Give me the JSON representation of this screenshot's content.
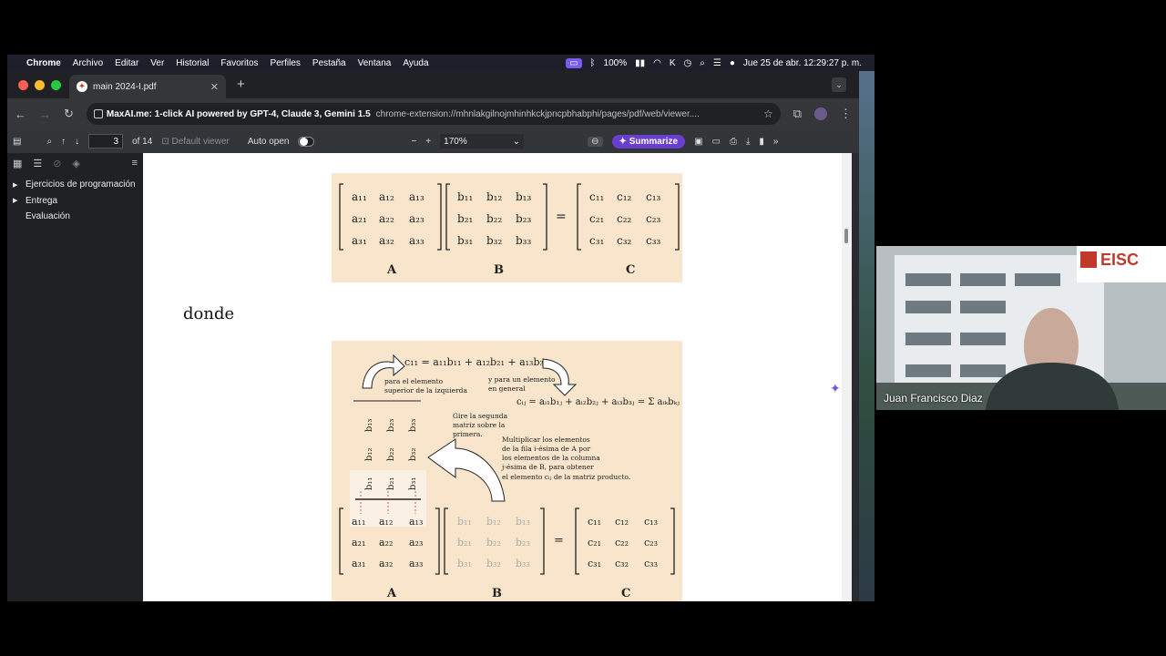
{
  "menubar": {
    "app": "Chrome",
    "items": [
      "Archivo",
      "Editar",
      "Ver",
      "Historial",
      "Favoritos",
      "Perfiles",
      "Pestaña",
      "Ventana",
      "Ayuda"
    ],
    "battery": "100%",
    "datetime": "Jue 25 de abr.  12:29:27 p. m."
  },
  "tab": {
    "title": "main 2024-I.pdf"
  },
  "address": {
    "extension_label": "MaxAI.me: 1-click AI powered by GPT-4, Claude 3, Gemini 1.5",
    "url": "chrome-extension://mhnlakgilnojmhinhkckjpncpbhabphi/pages/pdf/web/viewer...."
  },
  "pdf_toolbar": {
    "page_value": "3",
    "page_total": "of 14",
    "default_viewer": "Default viewer",
    "auto_open": "Auto open",
    "zoom": "170%",
    "summarize": "Summarize"
  },
  "outline": {
    "items": [
      {
        "label": "Ejercicios de programación",
        "expandable": true
      },
      {
        "label": "Entrega",
        "expandable": true
      },
      {
        "label": "Evaluación",
        "expandable": false
      }
    ]
  },
  "document": {
    "word": "donde",
    "fig1": {
      "labels": [
        "A",
        "B",
        "C"
      ]
    },
    "fig2": {
      "labels": [
        "A",
        "B",
        "C"
      ],
      "c11_formula": "c₁₁ = a₁₁b₁₁ + a₁₂b₂₁ + a₁₃b₃₁",
      "note_top_left_1": "para el elemento",
      "note_top_left_2": "superior de la izquierda",
      "note_general_1": "y para un elemento",
      "note_general_2": "en general",
      "cij_formula": "cᵢⱼ = aᵢ₁b₁ⱼ + aᵢ₂b₂ⱼ + aᵢ₃b₃ⱼ = Σ aᵢₖbₖⱼ",
      "turn_note_1": "Gire la segunda",
      "turn_note_2": "matriz sobre la",
      "turn_note_3": "primera.",
      "mult_note_1": "Multiplicar los elementos",
      "mult_note_2": "de la fila i-ésima de A por",
      "mult_note_3": "los elementos de la columna",
      "mult_note_4": "j-ésima de B, para obtener",
      "mult_note_5": "el elemento cᵢⱼ de la matriz producto."
    }
  },
  "webcam": {
    "name": "Juan Francisco Diaz",
    "logo": "EISC"
  }
}
